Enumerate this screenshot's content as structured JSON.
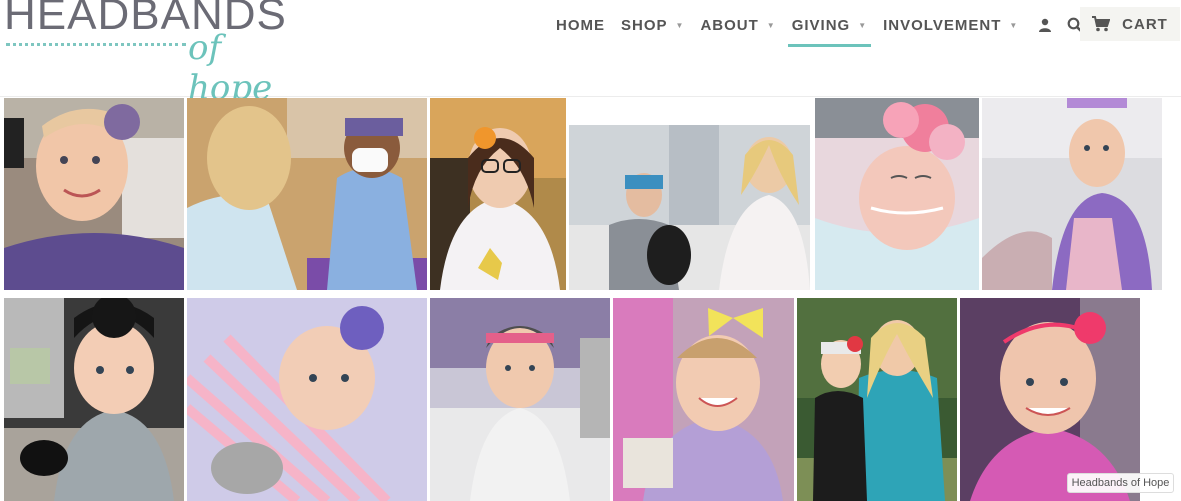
{
  "logo": {
    "main": "HEADBANDS",
    "sub": "of hope"
  },
  "nav": {
    "items": [
      {
        "label": "HOME",
        "has_dropdown": false
      },
      {
        "label": "SHOP",
        "has_dropdown": true
      },
      {
        "label": "ABOUT",
        "has_dropdown": true
      },
      {
        "label": "GIVING",
        "has_dropdown": true,
        "active": true
      },
      {
        "label": "INVOLVEMENT",
        "has_dropdown": true
      }
    ],
    "account_icon": "user-icon",
    "search_icon": "search-icon",
    "cart_label": "CART",
    "cart_icon": "cart-icon",
    "accent_color": "#6cc3bb"
  },
  "photos": [
    {
      "name": "photo-girl-purple-headband"
    },
    {
      "name": "photo-woman-with-child-mask"
    },
    {
      "name": "photo-girl-glasses-orange-flower"
    },
    {
      "name": "photo-boy-hospital-bed-teddy"
    },
    {
      "name": "photo-baby-pink-flower-headband"
    },
    {
      "name": "photo-girl-hospital-purple-dress"
    },
    {
      "name": "photo-toddler-black-headband"
    },
    {
      "name": "photo-baby-striped-purple-flower"
    },
    {
      "name": "photo-toddler-hospital-bed"
    },
    {
      "name": "photo-girl-yellow-bow"
    },
    {
      "name": "photo-girl-with-woman-outdoors"
    },
    {
      "name": "photo-girl-pink-flower-headband"
    }
  ],
  "caption": "Headbands of Hope"
}
